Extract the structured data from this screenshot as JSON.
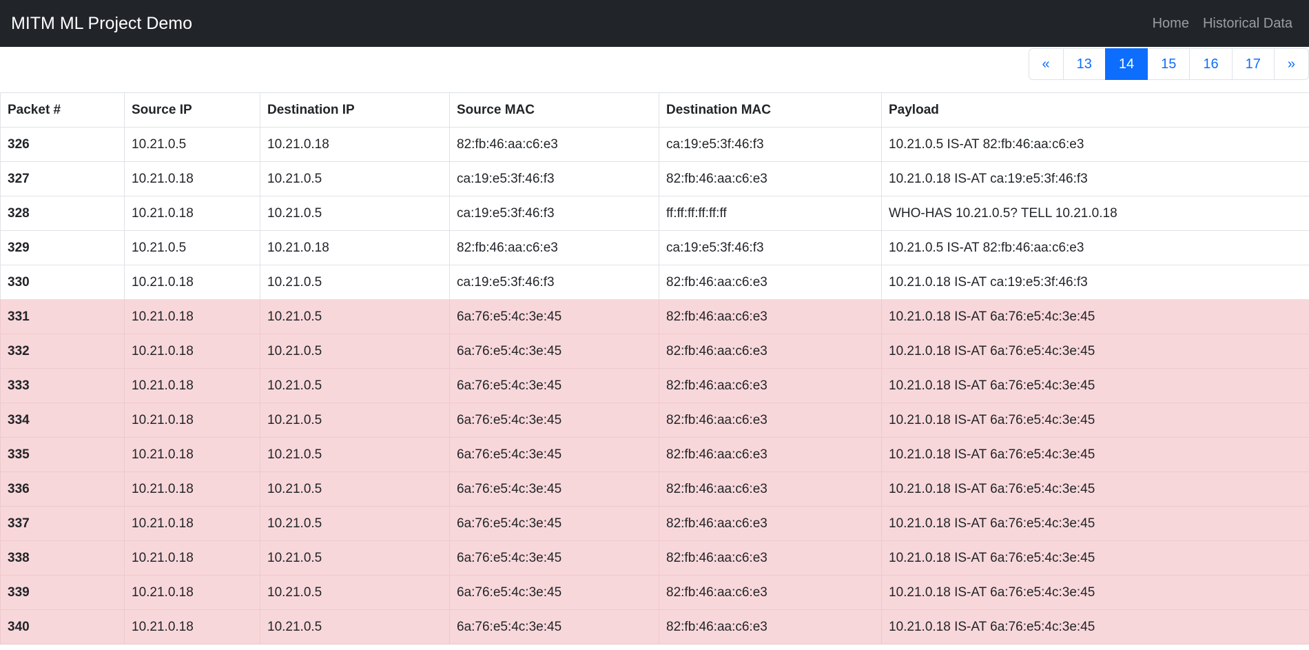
{
  "navbar": {
    "brand": "MITM ML Project Demo",
    "links": [
      "Home",
      "Historical Data"
    ]
  },
  "pagination": {
    "prev": "«",
    "next": "»",
    "pages": [
      "13",
      "14",
      "15",
      "16",
      "17"
    ],
    "active": "14"
  },
  "table": {
    "headers": [
      "Packet #",
      "Source IP",
      "Destination IP",
      "Source MAC",
      "Destination MAC",
      "Payload"
    ],
    "rows": [
      {
        "cells": [
          "326",
          "10.21.0.5",
          "10.21.0.18",
          "82:fb:46:aa:c6:e3",
          "ca:19:e5:3f:46:f3",
          "10.21.0.5 IS-AT 82:fb:46:aa:c6:e3"
        ],
        "flagged": false
      },
      {
        "cells": [
          "327",
          "10.21.0.18",
          "10.21.0.5",
          "ca:19:e5:3f:46:f3",
          "82:fb:46:aa:c6:e3",
          "10.21.0.18 IS-AT ca:19:e5:3f:46:f3"
        ],
        "flagged": false
      },
      {
        "cells": [
          "328",
          "10.21.0.18",
          "10.21.0.5",
          "ca:19:e5:3f:46:f3",
          "ff:ff:ff:ff:ff:ff",
          "WHO-HAS 10.21.0.5? TELL 10.21.0.18"
        ],
        "flagged": false
      },
      {
        "cells": [
          "329",
          "10.21.0.5",
          "10.21.0.18",
          "82:fb:46:aa:c6:e3",
          "ca:19:e5:3f:46:f3",
          "10.21.0.5 IS-AT 82:fb:46:aa:c6:e3"
        ],
        "flagged": false
      },
      {
        "cells": [
          "330",
          "10.21.0.18",
          "10.21.0.5",
          "ca:19:e5:3f:46:f3",
          "82:fb:46:aa:c6:e3",
          "10.21.0.18 IS-AT ca:19:e5:3f:46:f3"
        ],
        "flagged": false
      },
      {
        "cells": [
          "331",
          "10.21.0.18",
          "10.21.0.5",
          "6a:76:e5:4c:3e:45",
          "82:fb:46:aa:c6:e3",
          "10.21.0.18 IS-AT 6a:76:e5:4c:3e:45"
        ],
        "flagged": true
      },
      {
        "cells": [
          "332",
          "10.21.0.18",
          "10.21.0.5",
          "6a:76:e5:4c:3e:45",
          "82:fb:46:aa:c6:e3",
          "10.21.0.18 IS-AT 6a:76:e5:4c:3e:45"
        ],
        "flagged": true
      },
      {
        "cells": [
          "333",
          "10.21.0.18",
          "10.21.0.5",
          "6a:76:e5:4c:3e:45",
          "82:fb:46:aa:c6:e3",
          "10.21.0.18 IS-AT 6a:76:e5:4c:3e:45"
        ],
        "flagged": true
      },
      {
        "cells": [
          "334",
          "10.21.0.18",
          "10.21.0.5",
          "6a:76:e5:4c:3e:45",
          "82:fb:46:aa:c6:e3",
          "10.21.0.18 IS-AT 6a:76:e5:4c:3e:45"
        ],
        "flagged": true
      },
      {
        "cells": [
          "335",
          "10.21.0.18",
          "10.21.0.5",
          "6a:76:e5:4c:3e:45",
          "82:fb:46:aa:c6:e3",
          "10.21.0.18 IS-AT 6a:76:e5:4c:3e:45"
        ],
        "flagged": true
      },
      {
        "cells": [
          "336",
          "10.21.0.18",
          "10.21.0.5",
          "6a:76:e5:4c:3e:45",
          "82:fb:46:aa:c6:e3",
          "10.21.0.18 IS-AT 6a:76:e5:4c:3e:45"
        ],
        "flagged": true
      },
      {
        "cells": [
          "337",
          "10.21.0.18",
          "10.21.0.5",
          "6a:76:e5:4c:3e:45",
          "82:fb:46:aa:c6:e3",
          "10.21.0.18 IS-AT 6a:76:e5:4c:3e:45"
        ],
        "flagged": true
      },
      {
        "cells": [
          "338",
          "10.21.0.18",
          "10.21.0.5",
          "6a:76:e5:4c:3e:45",
          "82:fb:46:aa:c6:e3",
          "10.21.0.18 IS-AT 6a:76:e5:4c:3e:45"
        ],
        "flagged": true
      },
      {
        "cells": [
          "339",
          "10.21.0.18",
          "10.21.0.5",
          "6a:76:e5:4c:3e:45",
          "82:fb:46:aa:c6:e3",
          "10.21.0.18 IS-AT 6a:76:e5:4c:3e:45"
        ],
        "flagged": true
      },
      {
        "cells": [
          "340",
          "10.21.0.18",
          "10.21.0.5",
          "6a:76:e5:4c:3e:45",
          "82:fb:46:aa:c6:e3",
          "10.21.0.18 IS-AT 6a:76:e5:4c:3e:45"
        ],
        "flagged": true
      }
    ]
  },
  "colors": {
    "navbar_bg": "#212529",
    "accent": "#0d6efd",
    "flagged_row_bg": "#f8d7da"
  }
}
